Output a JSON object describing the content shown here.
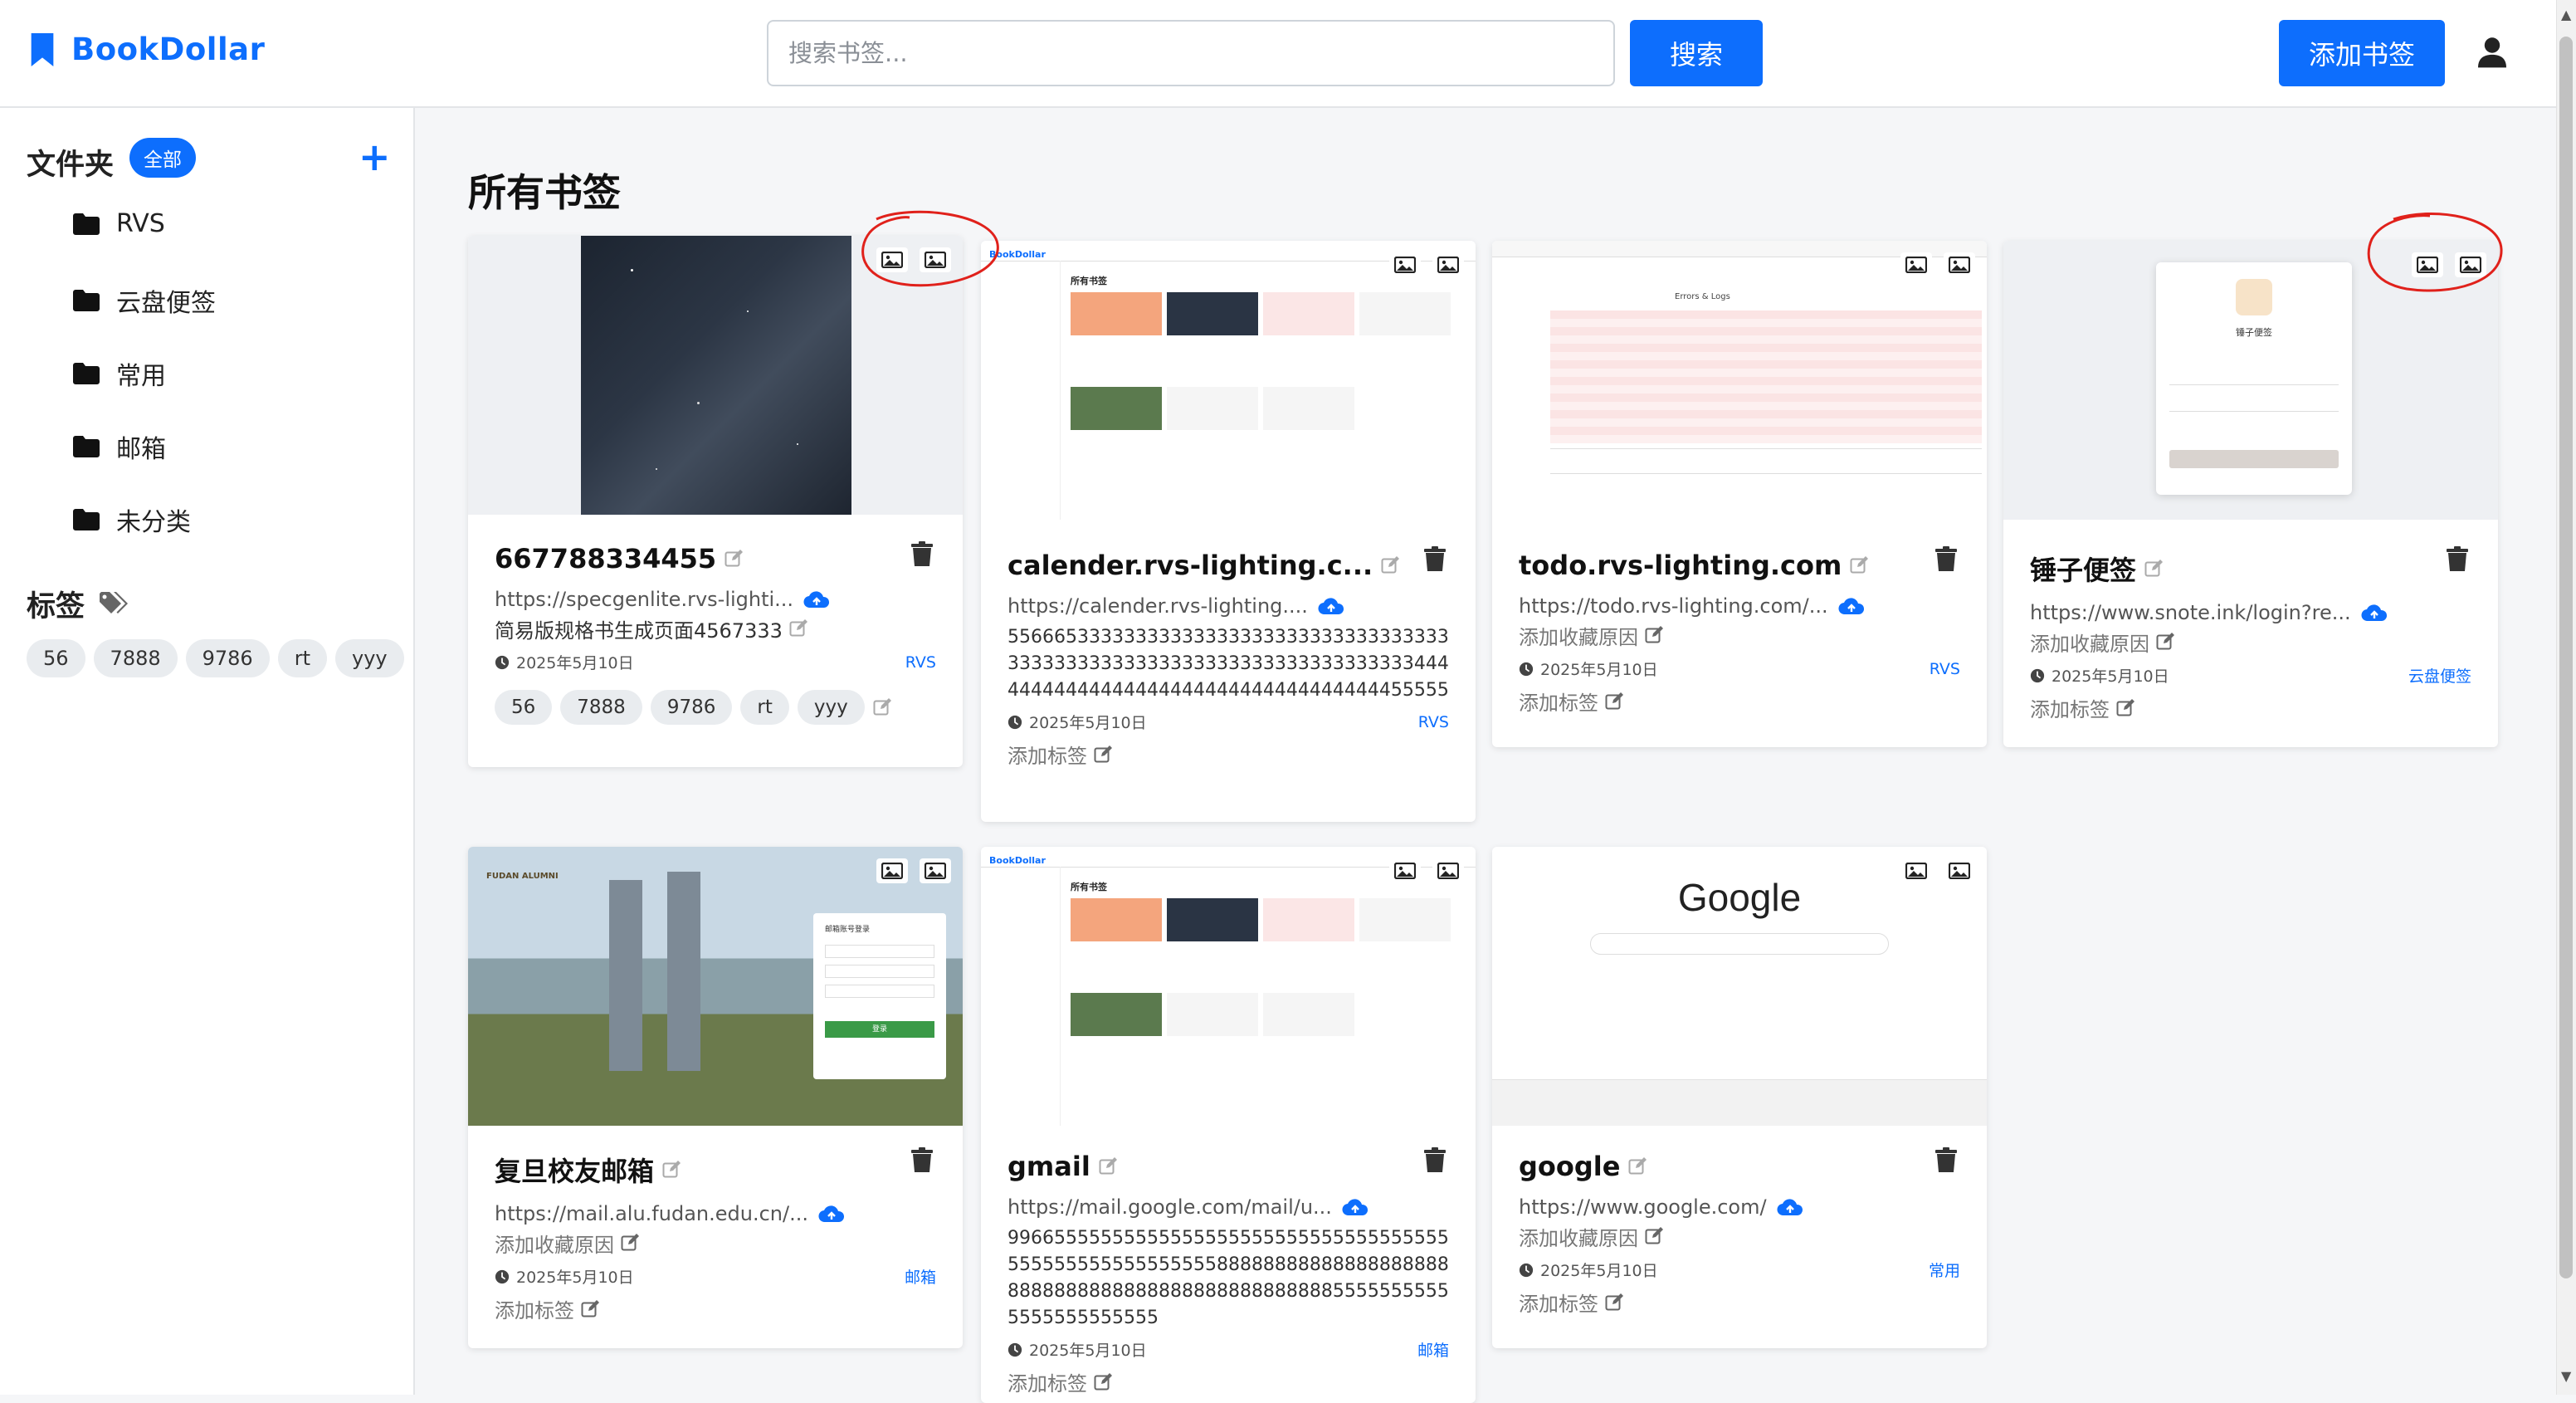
{
  "header": {
    "brand": "BookDollar",
    "search_placeholder": "搜索书签...",
    "search_button": "搜索",
    "add_button": "添加书签"
  },
  "sidebar": {
    "folders_title": "文件夹",
    "all_badge": "全部",
    "folders": [
      "RVS",
      "云盘便签",
      "常用",
      "邮箱",
      "未分类"
    ],
    "tags_title": "标签",
    "tags": [
      "56",
      "7888",
      "9786",
      "rt",
      "yyy"
    ]
  },
  "main": {
    "title": "所有书签",
    "cards": [
      {
        "title": "667788334455",
        "url": "https://specgenlite.rvs-lighti...",
        "desc": "简易版规格书生成页面4567333",
        "date": "2025年5月10日",
        "folder": "RVS",
        "tags": [
          "56",
          "7888",
          "9786",
          "rt",
          "yyy"
        ]
      },
      {
        "title": "calender.rvs-lighting.c...",
        "url": "https://calender.rvs-lighting....",
        "desc": "556665333333333333333333333333333333333333333333333333333333333333333333344444444444444444444444444444444444455555",
        "date": "2025年5月10日",
        "folder": "RVS",
        "add_tag": "添加标签"
      },
      {
        "title": "todo.rvs-lighting.com",
        "url": "https://todo.rvs-lighting.com/...",
        "desc": "添加收藏原因",
        "date": "2025年5月10日",
        "folder": "RVS",
        "add_tag": "添加标签"
      },
      {
        "title": "锤子便签",
        "url": "https://www.snote.ink/login?re...",
        "desc": "添加收藏原因",
        "date": "2025年5月10日",
        "folder": "云盘便签",
        "add_tag": "添加标签"
      },
      {
        "title": "复旦校友邮箱",
        "url": "https://mail.alu.fudan.edu.cn/...",
        "desc": "添加收藏原因",
        "date": "2025年5月10日",
        "folder": "邮箱",
        "add_tag": "添加标签"
      },
      {
        "title": "gmail",
        "url": "https://mail.google.com/mail/u...",
        "desc": "9966555555555555555555555555555555555555555555555555555588888888888888888888888888888888888888888888888855555555555555555555555",
        "date": "2025年5月10日",
        "folder": "邮箱",
        "add_tag": "添加标签"
      },
      {
        "title": "google",
        "url": "https://www.google.com/",
        "desc": "添加收藏原因",
        "date": "2025年5月10日",
        "folder": "常用",
        "add_tag": "添加标签"
      }
    ]
  },
  "thumbnails": {
    "mini_brand": "BookDollar",
    "mini_title": "所有书签",
    "fudan_brand": "FUDAN ALUMNI",
    "fudan_login": "邮箱账号登录",
    "fudan_button": "登录",
    "google_logo": "Google",
    "snote_name": "锤子便签",
    "todo_error_header": "Errors & Logs"
  },
  "colors": {
    "accent": "#0d6efd",
    "annotation": "#e0211b"
  }
}
